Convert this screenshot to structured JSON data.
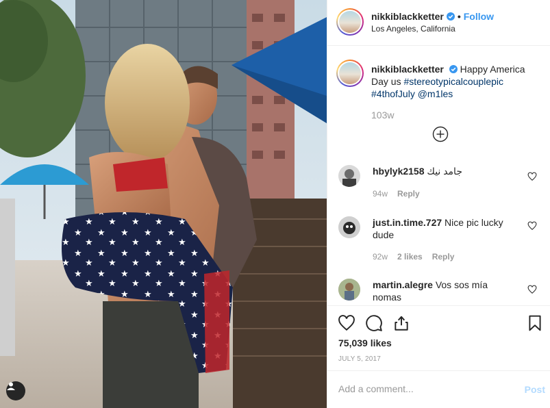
{
  "post": {
    "username": "nikkiblackketter",
    "verified": true,
    "follow_label": "Follow",
    "dot": "•",
    "location": "Los Angeles, California"
  },
  "caption": {
    "username": "nikkiblackketter",
    "text_1": "Happy America Day us",
    "hashtag_1": "#stereotypicalcouplepic",
    "hashtag_2": "#4thofJuly",
    "mention": "@m1les",
    "time": "103w"
  },
  "comments": [
    {
      "username": "hbylyk2158",
      "text": "جامد نيك",
      "time": "94w",
      "likes": "",
      "reply": "Reply"
    },
    {
      "username": "just.in.time.727",
      "text": "Nice pic lucky dude",
      "time": "92w",
      "likes": "2 likes",
      "reply": "Reply"
    },
    {
      "username": "martin.alegre",
      "text": "Vos sos mía nomas",
      "time": "",
      "likes": "",
      "reply": ""
    }
  ],
  "likes": "75,039 likes",
  "date": "JULY 5, 2017",
  "add_comment": {
    "placeholder": "Add a comment...",
    "post_label": "Post"
  },
  "icons": {
    "heart": "heart-icon",
    "comment": "comment-icon",
    "share": "share-icon",
    "save": "bookmark-icon",
    "load_more": "plus-circle-icon",
    "tag": "user-tag-icon",
    "verified": "verified-badge-icon"
  },
  "colors": {
    "link": "#003569",
    "follow": "#3897f0",
    "muted": "#999999",
    "post_disabled": "#b3dbff"
  }
}
